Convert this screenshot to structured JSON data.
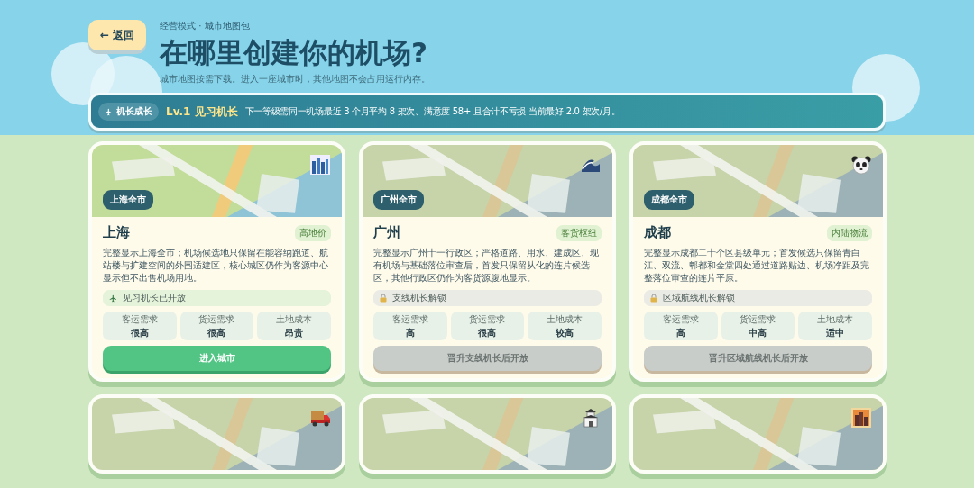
{
  "back_button": {
    "label": "← 返回"
  },
  "breadcrumb": "经营模式 · 城市地图包",
  "title": "在哪里创建你的机场?",
  "subtitle": "城市地图按需下载。进入一座城市时，其他地图不会占用运行内存。",
  "rank_banner": {
    "pill": "机长成长",
    "level": "Lv.1 见习机长",
    "note": "下一等级需同一机场最近 3 个月平均 8 架次、满意度 58+ 且合计不亏损 当前最好 2.0 架次/月。"
  },
  "cities": [
    {
      "map_tag": "上海全市",
      "name": "上海",
      "badge": "高地价",
      "description": "完整显示上海全市；机场候选地只保留在能容纳跑道、航站楼与扩建空间的外围适建区，核心城区仍作为客源中心显示但不出售机场用地。",
      "unlock": {
        "kind": "open",
        "text": "见习机长已开放"
      },
      "stats": [
        {
          "label": "客运需求",
          "value": "很高"
        },
        {
          "label": "货运需求",
          "value": "很高"
        },
        {
          "label": "土地成本",
          "value": "昂贵"
        }
      ],
      "button": {
        "label": "进入城市",
        "disabled": false
      }
    },
    {
      "map_tag": "广州全市",
      "name": "广州",
      "badge": "客货枢纽",
      "description": "完整显示广州十一行政区；严格道路、用水、建成区、现有机场与基础落位审查后，首发只保留从化的连片候选区，其他行政区仍作为客货源腹地显示。",
      "unlock": {
        "kind": "locked",
        "text": "支线机长解锁"
      },
      "stats": [
        {
          "label": "客运需求",
          "value": "高"
        },
        {
          "label": "货运需求",
          "value": "很高"
        },
        {
          "label": "土地成本",
          "value": "较高"
        }
      ],
      "button": {
        "label": "晋升支线机长后开放",
        "disabled": true
      }
    },
    {
      "map_tag": "成都全市",
      "name": "成都",
      "badge": "内陆物流",
      "description": "完整显示成都二十个区县级单元；首发候选只保留青白江、双流、郫都和金堂四处通过道路贴边、机场净距及完整落位审查的连片平原。",
      "unlock": {
        "kind": "locked",
        "text": "区域航线机长解锁"
      },
      "stats": [
        {
          "label": "客运需求",
          "value": "高"
        },
        {
          "label": "货运需求",
          "value": "中高"
        },
        {
          "label": "土地成本",
          "value": "适中"
        }
      ],
      "button": {
        "label": "晋升区域航线机长后开放",
        "disabled": true
      }
    }
  ]
}
